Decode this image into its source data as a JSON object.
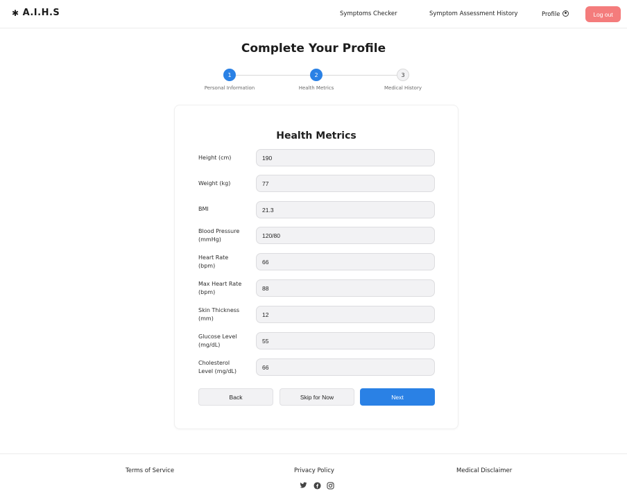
{
  "header": {
    "logo_mark": "✱",
    "logo_text": "A.I.H.S",
    "nav": {
      "symptoms_checker": "Symptoms Checker",
      "assessment_history": "Symptom Assessment History",
      "profile": "Profile"
    },
    "logout_label": "Log out"
  },
  "page": {
    "title": "Complete Your Profile"
  },
  "stepper": {
    "steps": [
      {
        "number": "1",
        "label": "Personal Information",
        "state": "complete"
      },
      {
        "number": "2",
        "label": "Health Metrics",
        "state": "active"
      },
      {
        "number": "3",
        "label": "Medical History",
        "state": "upcoming"
      }
    ]
  },
  "form": {
    "title": "Health Metrics",
    "fields": [
      {
        "label": "Height (cm)",
        "value": "190"
      },
      {
        "label": "Weight (kg)",
        "value": "77"
      },
      {
        "label": "BMI",
        "value": "21.3"
      },
      {
        "label": "Blood Pressure (mmHg)",
        "value": "120/80"
      },
      {
        "label": "Heart Rate (bpm)",
        "value": "66"
      },
      {
        "label": "Max Heart Rate (bpm)",
        "value": "88"
      },
      {
        "label": "Skin Thickness (mm)",
        "value": "12"
      },
      {
        "label": "Glucose Level (mg/dL)",
        "value": "55"
      },
      {
        "label": "Cholesterol Level (mg/dL)",
        "value": "66"
      }
    ],
    "buttons": {
      "back": "Back",
      "skip": "Skip for Now",
      "next": "Next"
    }
  },
  "footer": {
    "links": {
      "terms": "Terms of Service",
      "privacy": "Privacy Policy",
      "disclaimer": "Medical Disclaimer"
    },
    "social_icons": [
      "twitter-icon",
      "facebook-icon",
      "instagram-icon"
    ]
  },
  "colors": {
    "primary": "#2a81e5",
    "logout": "#f47c7c",
    "input_bg": "#f2f2f4"
  }
}
